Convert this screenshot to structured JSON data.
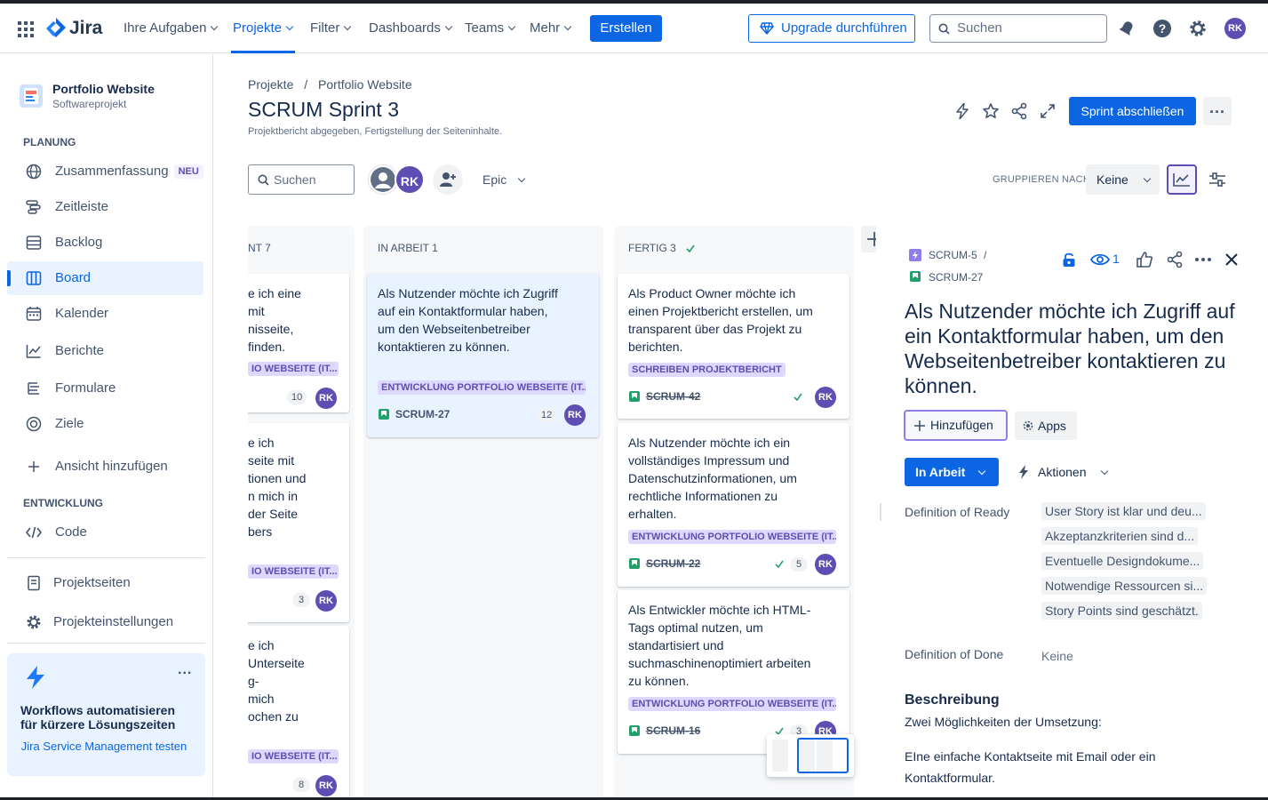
{
  "colors": {
    "brand": "#0c66e4",
    "avatar": "#5e4db2",
    "epic_lozenge": "#dfd8fd",
    "story": "#22a06b",
    "done_check": "#22a06b"
  },
  "topnav": {
    "logo": "Jira",
    "items": [
      "Ihre Aufgaben",
      "Projekte",
      "Filter",
      "Dashboards",
      "Teams",
      "Mehr"
    ],
    "active": "Projekte",
    "create": "Erstellen",
    "upgrade": "Upgrade durchführen",
    "search_placeholder": "Suchen",
    "avatar": "RK"
  },
  "sidebar": {
    "project_name": "Portfolio Website",
    "project_type": "Softwareprojekt",
    "planung_heading": "PLANUNG",
    "items": [
      {
        "label": "Zusammenfassung",
        "badge": "NEU",
        "icon": "globe-icon"
      },
      {
        "label": "Zeitleiste",
        "icon": "timeline-icon"
      },
      {
        "label": "Backlog",
        "icon": "backlog-icon"
      },
      {
        "label": "Board",
        "icon": "board-icon"
      },
      {
        "label": "Kalender",
        "icon": "calendar-icon"
      },
      {
        "label": "Berichte",
        "icon": "chart-icon"
      },
      {
        "label": "Formulare",
        "icon": "forms-icon"
      },
      {
        "label": "Ziele",
        "icon": "goal-icon"
      },
      {
        "label": "Ansicht hinzufügen",
        "icon": "plus-icon"
      }
    ],
    "active": "Board",
    "entwicklung_heading": "ENTWICKLUNG",
    "code": "Code",
    "projektseiten": "Projektseiten",
    "projekteinstellungen": "Projekteinstellungen",
    "promo": {
      "title": "Workflows automatisieren für kürzere Lösungszeiten",
      "link": "Jira Service Management testen",
      "more": "..."
    }
  },
  "header": {
    "breadcrumb": [
      "Projekte",
      "Portfolio Website"
    ],
    "breadcrumb_sep": "/",
    "title": "SCRUM Sprint 3",
    "subtitle": "Projektbericht abgegeben, Fertigstellung der Seiteninhalte.",
    "complete_sprint": "Sprint abschließen",
    "more": "..."
  },
  "filters": {
    "search_placeholder": "Suchen",
    "avatar": "RK",
    "epic": "Epic",
    "group_by_label": "GRUPPIEREN NACH",
    "group_by_value": "Keine"
  },
  "columns": {
    "col1": {
      "title": "NT 7",
      "cards": [
        {
          "lines": [
            "e ich eine",
            "mit",
            "nisseite,",
            "finden."
          ],
          "epic": "IO WEBSEITE (IT...",
          "est": "10",
          "avatar": "RK"
        },
        {
          "lines": [
            "e ich",
            "seite mit",
            "tionen und",
            "n mich in",
            "der Seite",
            "bers"
          ],
          "epic": "IO WEBSEITE (IT...",
          "est": "3",
          "avatar": "RK"
        },
        {
          "lines": [
            "e ich",
            "Unterseite",
            "g-",
            "mich",
            "ochen zu"
          ],
          "epic": "IO WEBSEITE (IT...",
          "est": "8",
          "avatar": "RK"
        }
      ]
    },
    "col2": {
      "title": "IN ARBEIT 1",
      "cards": [
        {
          "text": "Als Nutzender möchte ich Zugriff auf ein Kontaktformular haben, um den Webseitenbetreiber kontaktieren zu können.",
          "epic": "ENTWICKLUNG PORTFOLIO WEBSEITE (IT...",
          "key": "SCRUM-27",
          "est": "12",
          "avatar": "RK"
        }
      ]
    },
    "col3": {
      "title": "FERTIG 3",
      "cards": [
        {
          "text": "Als Product Owner möchte ich einen Projektbericht erstellen, um transparent über das Projekt zu berichten.",
          "epic": "SCHREIBEN PROJEKTBERICHT",
          "key": "SCRUM-42",
          "est": "",
          "avatar": "RK"
        },
        {
          "text": "Als Nutzender möchte ich ein vollständiges Impressum und Datenschutzinformationen, um rechtliche Informationen zu erhalten.",
          "epic": "ENTWICKLUNG PORTFOLIO WEBSEITE (IT...",
          "key": "SCRUM-22",
          "est": "5",
          "avatar": "RK"
        },
        {
          "text": "Als Entwickler möchte ich HTML-Tags optimal nutzen, um standartisiert und suchmaschinenoptimiert arbeiten zu können.",
          "epic": "ENTWICKLUNG PORTFOLIO WEBSEITE (IT...",
          "key": "SCRUM-16",
          "est": "3",
          "avatar": "RK"
        }
      ]
    }
  },
  "detail": {
    "parent_key": "SCRUM-5",
    "sep": "/",
    "key": "SCRUM-27",
    "watchers": "1",
    "title": "Als Nutzender möchte ich Zugriff auf ein Kontaktformular haben, um den Webseitenbetreiber kontaktieren zu können.",
    "add": "Hinzufügen",
    "apps": "Apps",
    "status": "In Arbeit",
    "actions": "Aktionen",
    "dor_label": "Definition of Ready",
    "dor_items": [
      "User Story ist klar und deu...",
      "Akzeptanzkriterien sind d...",
      "Eventuelle Designdokume...",
      "Notwendige Ressourcen si...",
      "Story Points sind geschätzt."
    ],
    "dod_label": "Definition of Done",
    "dod_value": "Keine",
    "desc_heading": "Beschreibung",
    "desc_line1": "Zwei Möglichkeiten der Umsetzung:",
    "desc_line2": "EIne einfache Kontaktseite mit Email oder ein Kontaktformular."
  }
}
